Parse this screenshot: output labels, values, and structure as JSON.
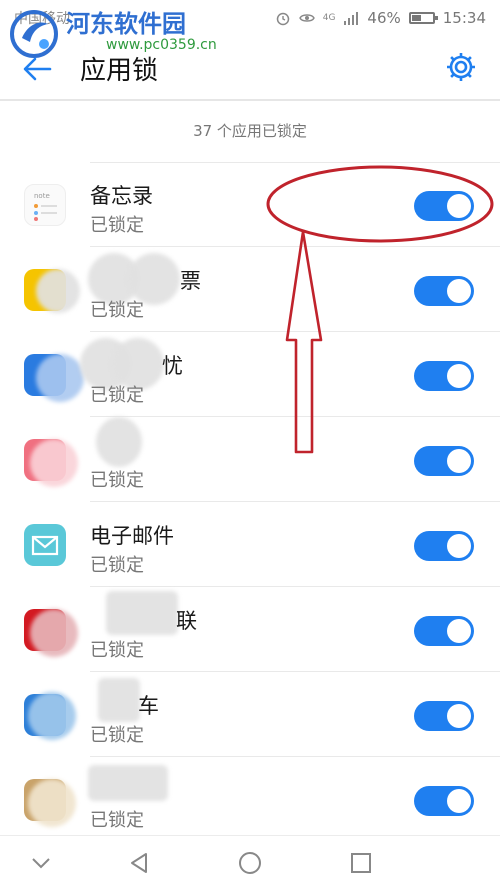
{
  "status_bar": {
    "carrier": "中国移动",
    "battery_text": "46%",
    "battery_level": 0.46,
    "time": "15:34",
    "network": "4G"
  },
  "watermark": {
    "title": "河东软件园",
    "url": "www.pc0359.cn"
  },
  "app_bar": {
    "title": "应用锁"
  },
  "summary": "37 个应用已锁定",
  "apps": [
    {
      "name": "备忘录",
      "status": "已锁定",
      "locked": true,
      "icon_color": "#ffffff"
    },
    {
      "name": "票",
      "status": "已锁定",
      "locked": true,
      "icon_color": "#f5c400"
    },
    {
      "name": "忧",
      "status": "已锁定",
      "locked": true,
      "icon_color": "#2a7be0"
    },
    {
      "name": "",
      "status": "已锁定",
      "locked": true,
      "icon_color": "#f07080"
    },
    {
      "name": "电子邮件",
      "status": "已锁定",
      "locked": true,
      "icon_color": "#5ac8d8"
    },
    {
      "name": "联",
      "status": "已锁定",
      "locked": true,
      "icon_color": "#d31a22"
    },
    {
      "name": "车",
      "status": "已锁定",
      "locked": true,
      "icon_color": "#2d7fd8"
    },
    {
      "name": "",
      "status": "已锁定",
      "locked": true,
      "icon_color": "#c9a36a"
    }
  ],
  "colors": {
    "accent": "#1f7ff0",
    "annotation": "#c0232c"
  }
}
